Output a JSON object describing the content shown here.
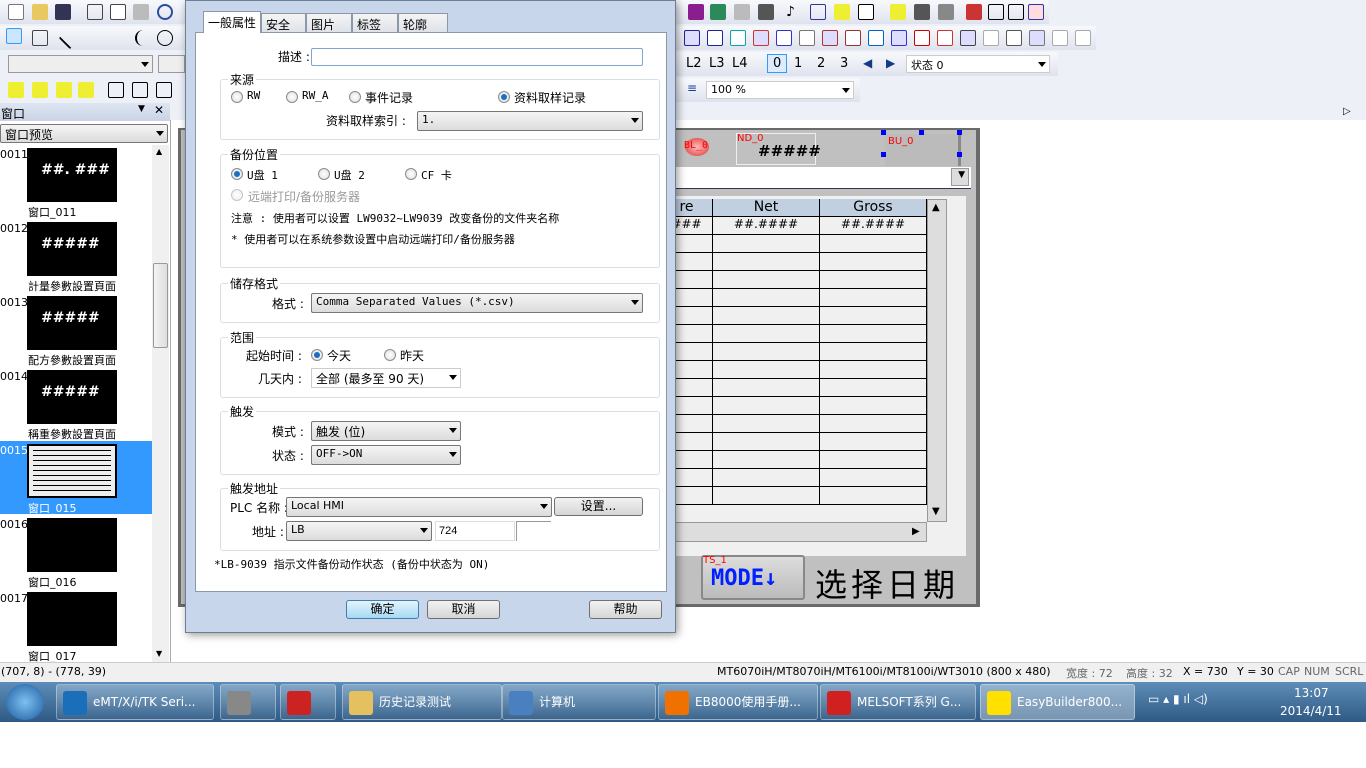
{
  "toolbar": {
    "layers": [
      "L2",
      "L3",
      "L4"
    ],
    "states": [
      "0",
      "1",
      "2",
      "3"
    ],
    "state_combo": "状态 0",
    "zoom_combo": "100 %"
  },
  "left_panel": {
    "title": "窗口",
    "view_select": "窗口预览",
    "windows": [
      {
        "num": "0011",
        "name": "窗口_011",
        "thumb_text": "##. ###"
      },
      {
        "num": "0012",
        "name": "計量參數設置頁面",
        "thumb_text": "#####"
      },
      {
        "num": "0013",
        "name": "配方參數設置頁面",
        "thumb_text": "#####"
      },
      {
        "num": "0014",
        "name": "稱重參數設置頁面",
        "thumb_text": "#####"
      },
      {
        "num": "0015",
        "name": "窗口_015",
        "selected": true
      },
      {
        "num": "0016",
        "name": "窗口_016"
      },
      {
        "num": "0017",
        "name": "窗口_017"
      }
    ]
  },
  "canvas": {
    "bl_label": "BL_0",
    "nd_label": "ND_0",
    "nd_value": "#####",
    "bu_label": "BU_0",
    "table_headers": [
      "re",
      "Net",
      "Gross"
    ],
    "table_first_row": [
      "###",
      "##.####",
      "##.####"
    ],
    "ts_label": "TS_1",
    "mode_button": "MODE↓",
    "select_date": "选择日期"
  },
  "dialog": {
    "tabs": [
      "一般属性",
      "安全",
      "图片",
      "标签",
      "轮廓"
    ],
    "active_tab": "一般属性",
    "description_label": "描述 :",
    "description_value": "",
    "source": {
      "title": "来源",
      "options": [
        "RW",
        "RW_A",
        "事件记录",
        "资料取样记录"
      ],
      "selected": "资料取样记录",
      "index_label": "资料取样索引 :",
      "index_value": "1."
    },
    "backup": {
      "title": "备份位置",
      "options": [
        "U盘 1",
        "U盘 2",
        "CF 卡"
      ],
      "selected": "U盘 1",
      "remote": "远端打印/备份服务器",
      "note1": "注意 : 使用者可以设置 LW9032~LW9039 改变备份的文件夹名称",
      "note2": "* 使用者可以在系统参数设置中启动远端打印/备份服务器"
    },
    "format": {
      "title": "储存格式",
      "label": "格式 :",
      "value": "Comma Separated Values (*.csv)"
    },
    "range": {
      "title": "范围",
      "start_label": "起始时间 :",
      "start_options": [
        "今天",
        "昨天"
      ],
      "start_selected": "今天",
      "days_label": "几天内 :",
      "days_value": "全部 (最多至 90 天)"
    },
    "trigger": {
      "title": "触发",
      "mode_label": "模式 :",
      "mode_value": "触发 (位)",
      "state_label": "状态 :",
      "state_value": "OFF->ON"
    },
    "trigger_address": {
      "title": "触发地址",
      "plc_label": "PLC 名称 :",
      "plc_value": "Local HMI",
      "settings_button": "设置...",
      "addr_label": "地址 :",
      "addr_type": "LB",
      "addr_value": "724"
    },
    "footnote": "*LB-9039 指示文件备份动作状态 (备份中状态为 ON)",
    "ok": "确定",
    "cancel": "取消",
    "help": "帮助"
  },
  "statusbar": {
    "coords": "(707, 8) - (778, 39)",
    "model": "MT6070iH/MT8070iH/MT6100i/MT8100i/WT3010 (800 x 480)",
    "width": "宽度 : 72",
    "height": "高度 : 32",
    "x": "X = 730",
    "y": "Y = 30",
    "cap": "CAP",
    "num": "NUM",
    "scrl": "SCRL"
  },
  "taskbar": {
    "items": [
      "eMT/X/i/TK Seri...",
      "",
      "",
      "历史记录测试",
      "计算机",
      "EB8000使用手册...",
      "MELSOFT系列 G...",
      "EasyBuilder800..."
    ],
    "time": "13:07",
    "date": "2014/4/11"
  }
}
